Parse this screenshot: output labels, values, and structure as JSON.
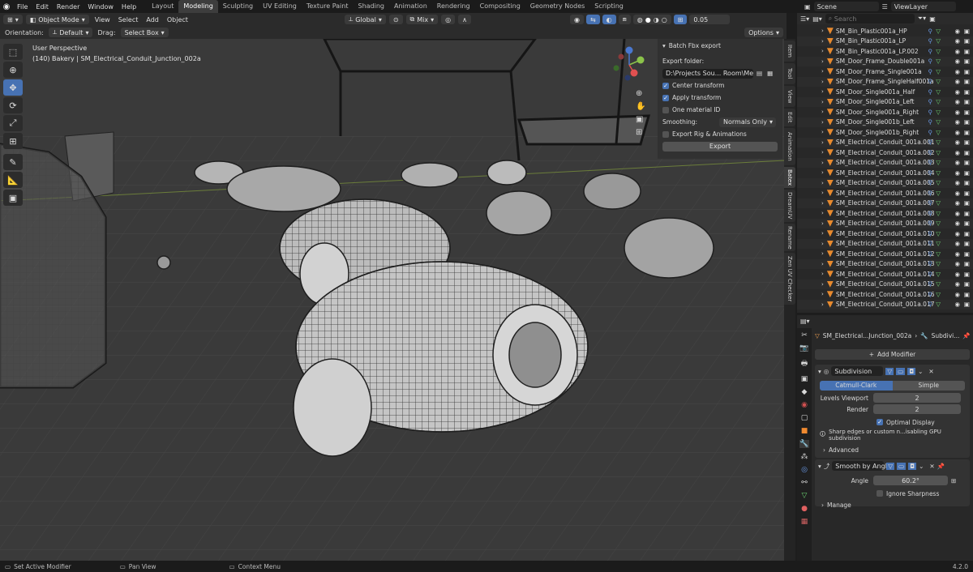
{
  "menu": [
    "File",
    "Edit",
    "Render",
    "Window",
    "Help"
  ],
  "workspaces": [
    "Layout",
    "Modeling",
    "Sculpting",
    "UV Editing",
    "Texture Paint",
    "Shading",
    "Animation",
    "Rendering",
    "Compositing",
    "Geometry Nodes",
    "Scripting"
  ],
  "active_workspace": "Modeling",
  "scene": {
    "name": "Scene",
    "viewlayer": "ViewLayer"
  },
  "header": {
    "mode": "Object Mode",
    "view": "View",
    "select": "Select",
    "add": "Add",
    "object": "Object",
    "transform": "Global",
    "pivot": "Mix",
    "snap_value": "0.05"
  },
  "header2": {
    "orientation_label": "Orientation:",
    "orientation": "Default",
    "drag_label": "Drag:",
    "drag": "Select Box",
    "options": "Options"
  },
  "viewport": {
    "perspective": "User Perspective",
    "info": "(140) Bakery | SM_Electrical_Conduit_Junction_002a"
  },
  "npanel": {
    "title": "Batch Fbx export",
    "export_folder_label": "Export folder:",
    "export_folder": "D:\\Projects Sou... Room\\Meshes\\",
    "center_transform": "Center transform",
    "apply_transform": "Apply transform",
    "one_material": "One material ID",
    "smoothing_label": "Smoothing:",
    "smoothing": "Normals Only",
    "export_rig": "Export Rig & Animations",
    "export_button": "Export"
  },
  "side_tabs": [
    "Item",
    "Tool",
    "View",
    "Edit",
    "Animation",
    "Batex",
    "DreamUV",
    "Rename",
    "Zen UV Checker"
  ],
  "active_side_tab": "Batex",
  "outliner": {
    "search_placeholder": "Search",
    "items": [
      "SM_Bin_Plastic001a_HP",
      "SM_Bin_Plastic001a_LP",
      "SM_Bin_Plastic001a_LP.002",
      "SM_Door_Frame_Double001a",
      "SM_Door_Frame_Single001a",
      "SM_Door_Frame_SingleHalf001a",
      "SM_Door_Single001a_Half",
      "SM_Door_Single001a_Left",
      "SM_Door_Single001a_Right",
      "SM_Door_Single001b_Left",
      "SM_Door_Single001b_Right",
      "SM_Electrical_Conduit_001a.001",
      "SM_Electrical_Conduit_001a.002",
      "SM_Electrical_Conduit_001a.003",
      "SM_Electrical_Conduit_001a.004",
      "SM_Electrical_Conduit_001a.005",
      "SM_Electrical_Conduit_001a.006",
      "SM_Electrical_Conduit_001a.007",
      "SM_Electrical_Conduit_001a.008",
      "SM_Electrical_Conduit_001a.009",
      "SM_Electrical_Conduit_001a.010",
      "SM_Electrical_Conduit_001a.011",
      "SM_Electrical_Conduit_001a.012",
      "SM_Electrical_Conduit_001a.013",
      "SM_Electrical_Conduit_001a.014",
      "SM_Electrical_Conduit_001a.015",
      "SM_Electrical_Conduit_001a.016",
      "SM_Electrical_Conduit_001a.017"
    ]
  },
  "properties": {
    "breadcrumb_object": "SM_Electrical...Junction_002a",
    "breadcrumb_modifier": "Subdivi...",
    "add_modifier": "Add Modifier",
    "subdivision": {
      "name": "Subdivision",
      "catmull": "Catmull-Clark",
      "simple": "Simple",
      "levels_label": "Levels Viewport",
      "levels": "2",
      "render_label": "Render",
      "render": "2",
      "optimal": "Optimal Display",
      "warning": "Sharp edges or custom n...isabling GPU subdivision",
      "advanced": "Advanced"
    },
    "smooth": {
      "name": "Smooth by Angle",
      "angle_label": "Angle",
      "angle": "60.2°",
      "ignore": "Ignore Sharpness",
      "manage": "Manage"
    }
  },
  "status": {
    "left": "Set Active Modifier",
    "mid": "Pan View",
    "right": "Context Menu",
    "version": "4.2.0"
  },
  "colors": {
    "accent": "#4772b3",
    "object_orange": "#e88a2e",
    "bg": "#1d1d1d"
  }
}
